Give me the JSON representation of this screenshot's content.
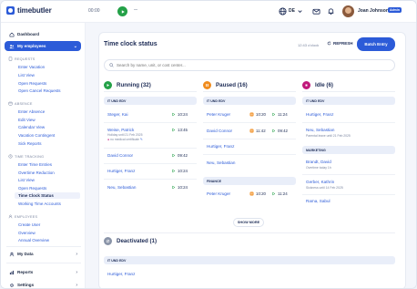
{
  "app": {
    "logo": "timebutler"
  },
  "topbar": {
    "timer": "00:00",
    "timer_dash": "--",
    "language": "DE",
    "user_name": "Joan Johnson",
    "admin_badge": "Admin"
  },
  "sidebar": {
    "dashboard": "Dashboard",
    "my_employees": "My employees",
    "requests_head": "REQUESTS",
    "requests": [
      "Enter Vacation",
      "List View",
      "Open Requests",
      "Open Cancel Requests"
    ],
    "absence_head": "ABSENCE",
    "absence": [
      "Enter Absence",
      "Edit View",
      "Calendar View",
      "Vacation Contingent",
      "Sick Reports"
    ],
    "time_head": "TIME TRACKING",
    "time": [
      "Enter Time Entries",
      "Overtime Reduction",
      "List View",
      "Open Requests",
      "Time Clock Status",
      "Working Time Accounts"
    ],
    "employees_head": "EMPLOYEES",
    "employees": [
      "Create User",
      "Overview",
      "Annual Overview"
    ],
    "my_data": "My Data",
    "reports": "Reports",
    "settings": "Settings"
  },
  "main": {
    "title": "Time clock status",
    "clock_time": "12:43 o'clock",
    "refresh": "REFRESH",
    "batch_entry": "Batch Entry",
    "search_placeholder": "Search by name, unit, or cost center...",
    "show_more": "SHOW MORE"
  },
  "columns": {
    "running": {
      "title": "Running (32)",
      "color": "#24a148",
      "group": "IT UND EDV",
      "rows": [
        {
          "name": "Steger, Kai",
          "time": "10:24"
        },
        {
          "name": "Weise, Patrick",
          "time": "13:45",
          "note": "Holiday until 21 Feb 2025",
          "sub": "no medical certificate"
        },
        {
          "name": "David Connor",
          "time": "09:42"
        },
        {
          "name": "Hurtiger, Franz",
          "time": "10:24"
        },
        {
          "name": "Neu, Sebastian",
          "time": "10:24"
        }
      ]
    },
    "paused": {
      "title": "Paused (16)",
      "color": "#f08c1e",
      "group": "IT UND EDV",
      "rows": [
        {
          "name": "Peter Kruger",
          "time": "10:20",
          "time2": "11:24"
        },
        {
          "name": "David Connor",
          "time": "11:42",
          "time2": "09:42"
        },
        {
          "name": "Hurtiger, Franz",
          "time": "",
          "time2": ""
        },
        {
          "name": "Neu, Sebastian",
          "time": "",
          "time2": ""
        }
      ],
      "group2": "FINANCE",
      "rows2": [
        {
          "name": "Peter Kruger",
          "time": "10:20",
          "time2": "11:24"
        }
      ]
    },
    "idle": {
      "title": "Idle (6)",
      "color": "#c0197b",
      "group": "IT UND EDV",
      "rows": [
        {
          "name": "Hurtiger, Franz",
          "note": ""
        },
        {
          "name": "Neu, Sebastian",
          "note": "Parental leave until 21 Feb 2025"
        }
      ],
      "group2": "MARKETING",
      "rows2": [
        {
          "name": "Brandt, David",
          "note": "Overtime today 1h"
        },
        {
          "name": "Gerber, Kathrin",
          "note": "Sickness until 14 Feb 2025"
        },
        {
          "name": "Rama, Sabul",
          "note": ""
        }
      ]
    },
    "deactivated": {
      "title": "Deactivated (1)",
      "group": "IT UND EDV",
      "rows": [
        {
          "name": "Hurtiger, Franz"
        }
      ]
    }
  }
}
